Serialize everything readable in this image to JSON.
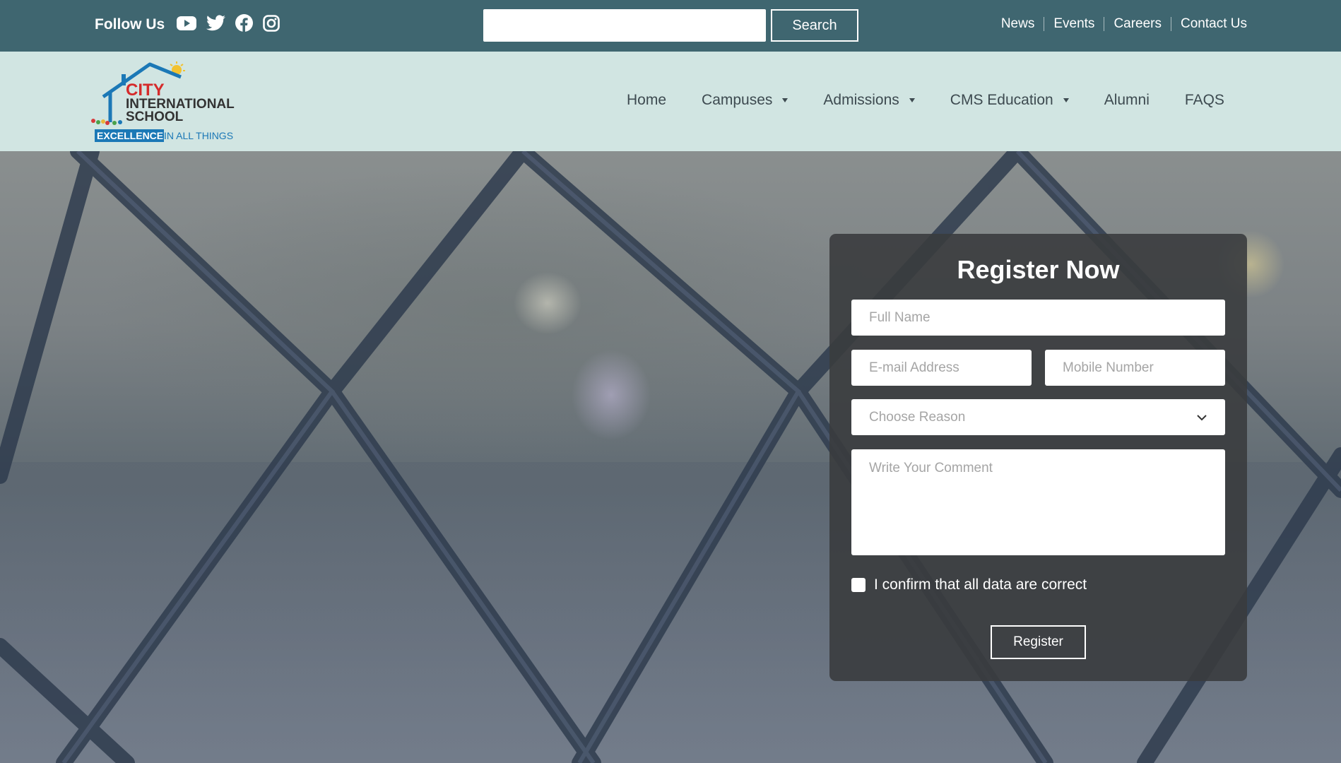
{
  "topbar": {
    "follow_label": "Follow Us",
    "social_icons": [
      "youtube-icon",
      "twitter-icon",
      "facebook-icon",
      "instagram-icon"
    ],
    "search": {
      "value": "",
      "button_label": "Search"
    },
    "links": [
      "News",
      "Events",
      "Careers",
      "Contact Us"
    ],
    "background_color": "#3f6670"
  },
  "logo": {
    "line1": "CITY",
    "line2": "INTERNATIONAL",
    "line3": "SCHOOL",
    "tagline_highlight": "EXCELLENCE",
    "tagline_rest": " IN ALL THINGS"
  },
  "nav": {
    "background_color": "#d1e5e2",
    "items": [
      {
        "label": "Home",
        "dropdown": false
      },
      {
        "label": "Campuses",
        "dropdown": true
      },
      {
        "label": "Admissions",
        "dropdown": true
      },
      {
        "label": "CMS Education",
        "dropdown": true
      },
      {
        "label": "Alumni",
        "dropdown": false
      },
      {
        "label": "FAQS",
        "dropdown": false
      }
    ]
  },
  "register": {
    "title": "Register Now",
    "full_name_placeholder": "Full Name",
    "email_placeholder": "E-mail Address",
    "mobile_placeholder": "Mobile Number",
    "reason_placeholder": "Choose Reason",
    "comment_placeholder": "Write Your Comment",
    "confirm_label": "I confirm that all data are correct",
    "confirm_checked": false,
    "button_label": "Register"
  }
}
